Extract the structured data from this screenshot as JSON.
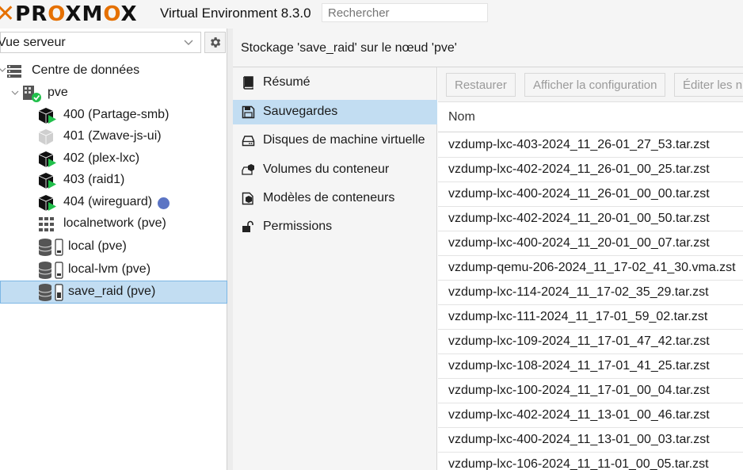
{
  "header": {
    "brand": "PROXMOX",
    "title": "Virtual Environment 8.3.0",
    "search_placeholder": "Rechercher"
  },
  "left": {
    "view_select": "Vue serveur",
    "tree": [
      {
        "label": "Centre de données",
        "icon": "datacenter-icon"
      },
      {
        "label": "pve",
        "icon": "node-online-icon"
      },
      {
        "label": "400 (Partage-smb)",
        "icon": "container-running-icon"
      },
      {
        "label": "401 (Zwave-js-ui)",
        "icon": "container-stopped-icon"
      },
      {
        "label": "402 (plex-lxc)",
        "icon": "container-running-icon"
      },
      {
        "label": "403 (raid1)",
        "icon": "container-running-icon"
      },
      {
        "label": "404 (wireguard)",
        "icon": "container-running-icon",
        "badge_color": "#5b74c4"
      },
      {
        "label": "localnetwork (pve)",
        "icon": "network-grid-icon"
      },
      {
        "label": "local (pve)",
        "icon": "storage-icon"
      },
      {
        "label": "local-lvm (pve)",
        "icon": "storage-icon"
      },
      {
        "label": "save_raid (pve)",
        "icon": "storage-icon",
        "selected": true
      }
    ]
  },
  "main": {
    "title": "Stockage 'save_raid' sur le nœud 'pve'",
    "menu": [
      {
        "label": "Résumé",
        "icon": "book-icon"
      },
      {
        "label": "Sauvegardes",
        "icon": "floppy-icon",
        "active": true
      },
      {
        "label": "Disques de machine virtuelle",
        "icon": "hdd-icon"
      },
      {
        "label": "Volumes du conteneur",
        "icon": "cube-volume-icon"
      },
      {
        "label": "Modèles de conteneurs",
        "icon": "template-icon"
      },
      {
        "label": "Permissions",
        "icon": "unlock-icon"
      }
    ],
    "toolbar": {
      "restore": "Restaurer",
      "show_config": "Afficher la configuration",
      "edit_notes": "Éditer les n"
    },
    "column_header": "Nom",
    "rows": [
      "vzdump-lxc-403-2024_11_26-01_27_53.tar.zst",
      "vzdump-lxc-402-2024_11_26-01_00_25.tar.zst",
      "vzdump-lxc-400-2024_11_26-01_00_00.tar.zst",
      "vzdump-lxc-402-2024_11_20-01_00_50.tar.zst",
      "vzdump-lxc-400-2024_11_20-01_00_07.tar.zst",
      "vzdump-qemu-206-2024_11_17-02_41_30.vma.zst",
      "vzdump-lxc-114-2024_11_17-02_35_29.tar.zst",
      "vzdump-lxc-111-2024_11_17-01_59_02.tar.zst",
      "vzdump-lxc-109-2024_11_17-01_47_42.tar.zst",
      "vzdump-lxc-108-2024_11_17-01_41_25.tar.zst",
      "vzdump-lxc-100-2024_11_17-01_00_04.tar.zst",
      "vzdump-lxc-402-2024_11_13-01_00_46.tar.zst",
      "vzdump-lxc-400-2024_11_13-01_00_03.tar.zst",
      "vzdump-lxc-106-2024_11_11-01_00_05.tar.zst"
    ]
  }
}
